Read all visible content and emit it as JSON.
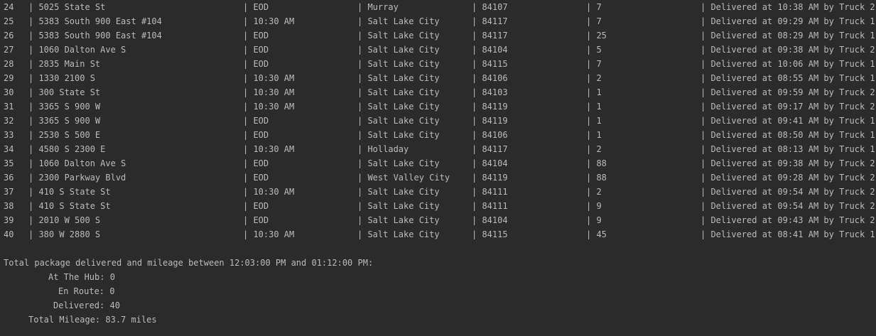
{
  "rows": [
    {
      "id": "24",
      "address": "| 5025 State St",
      "deadline": "| EOD",
      "city": "| Murray",
      "zip": "| 84107",
      "weight": "| 7",
      "status": "| Delivered at 10:38 AM by Truck 2"
    },
    {
      "id": "25",
      "address": "| 5383 South 900 East #104",
      "deadline": "| 10:30 AM",
      "city": "| Salt Lake City",
      "zip": "| 84117",
      "weight": "| 7",
      "status": "| Delivered at 09:29 AM by Truck 1"
    },
    {
      "id": "26",
      "address": "| 5383 South 900 East #104",
      "deadline": "| EOD",
      "city": "| Salt Lake City",
      "zip": "| 84117",
      "weight": "| 25",
      "status": "| Delivered at 08:29 AM by Truck 1"
    },
    {
      "id": "27",
      "address": "| 1060 Dalton Ave S",
      "deadline": "| EOD",
      "city": "| Salt Lake City",
      "zip": "| 84104",
      "weight": "| 5",
      "status": "| Delivered at 09:38 AM by Truck 2"
    },
    {
      "id": "28",
      "address": "| 2835 Main St",
      "deadline": "| EOD",
      "city": "| Salt Lake City",
      "zip": "| 84115",
      "weight": "| 7",
      "status": "| Delivered at 10:06 AM by Truck 1"
    },
    {
      "id": "29",
      "address": "| 1330 2100 S",
      "deadline": "| 10:30 AM",
      "city": "| Salt Lake City",
      "zip": "| 84106",
      "weight": "| 2",
      "status": "| Delivered at 08:55 AM by Truck 1"
    },
    {
      "id": "30",
      "address": "| 300 State St",
      "deadline": "| 10:30 AM",
      "city": "| Salt Lake City",
      "zip": "| 84103",
      "weight": "| 1",
      "status": "| Delivered at 09:59 AM by Truck 2"
    },
    {
      "id": "31",
      "address": "| 3365 S 900 W",
      "deadline": "| 10:30 AM",
      "city": "| Salt Lake City",
      "zip": "| 84119",
      "weight": "| 1",
      "status": "| Delivered at 09:17 AM by Truck 2"
    },
    {
      "id": "32",
      "address": "| 3365 S 900 W",
      "deadline": "| EOD",
      "city": "| Salt Lake City",
      "zip": "| 84119",
      "weight": "| 1",
      "status": "| Delivered at 09:41 AM by Truck 1"
    },
    {
      "id": "33",
      "address": "| 2530 S 500 E",
      "deadline": "| EOD",
      "city": "| Salt Lake City",
      "zip": "| 84106",
      "weight": "| 1",
      "status": "| Delivered at 08:50 AM by Truck 1"
    },
    {
      "id": "34",
      "address": "| 4580 S 2300 E",
      "deadline": "| 10:30 AM",
      "city": "| Holladay",
      "zip": "| 84117",
      "weight": "| 2",
      "status": "| Delivered at 08:13 AM by Truck 1"
    },
    {
      "id": "35",
      "address": "| 1060 Dalton Ave S",
      "deadline": "| EOD",
      "city": "| Salt Lake City",
      "zip": "| 84104",
      "weight": "| 88",
      "status": "| Delivered at 09:38 AM by Truck 2"
    },
    {
      "id": "36",
      "address": "| 2300 Parkway Blvd",
      "deadline": "| EOD",
      "city": "| West Valley City",
      "zip": "| 84119",
      "weight": "| 88",
      "status": "| Delivered at 09:28 AM by Truck 2"
    },
    {
      "id": "37",
      "address": "| 410 S State St",
      "deadline": "| 10:30 AM",
      "city": "| Salt Lake City",
      "zip": "| 84111",
      "weight": "| 2",
      "status": "| Delivered at 09:54 AM by Truck 2"
    },
    {
      "id": "38",
      "address": "| 410 S State St",
      "deadline": "| EOD",
      "city": "| Salt Lake City",
      "zip": "| 84111",
      "weight": "| 9",
      "status": "| Delivered at 09:54 AM by Truck 2"
    },
    {
      "id": "39",
      "address": "| 2010 W 500 S",
      "deadline": "| EOD",
      "city": "| Salt Lake City",
      "zip": "| 84104",
      "weight": "| 9",
      "status": "| Delivered at 09:43 AM by Truck 2"
    },
    {
      "id": "40",
      "address": "| 380 W 2880 S",
      "deadline": "| 10:30 AM",
      "city": "| Salt Lake City",
      "zip": "| 84115",
      "weight": "| 45",
      "status": "| Delivered at 08:41 AM by Truck 1"
    }
  ],
  "summary": {
    "heading": "Total package delivered and mileage between 12:03:00 PM and 01:12:00 PM:",
    "at_hub": "At The Hub: 0",
    "en_route": "En Route: 0",
    "delivered": "Delivered: 40",
    "total_mileage": "Total Mileage: 83.7 miles"
  }
}
